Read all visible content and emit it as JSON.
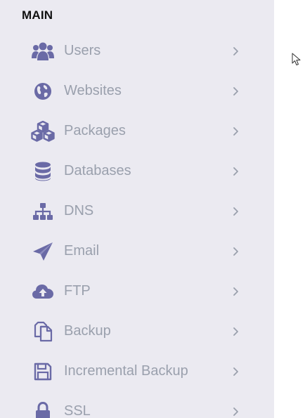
{
  "sidebar": {
    "section_title": "MAIN",
    "items": [
      {
        "label": "Users",
        "icon": "users-icon"
      },
      {
        "label": "Websites",
        "icon": "globe-icon"
      },
      {
        "label": "Packages",
        "icon": "cubes-icon"
      },
      {
        "label": "Databases",
        "icon": "database-icon"
      },
      {
        "label": "DNS",
        "icon": "sitemap-icon"
      },
      {
        "label": "Email",
        "icon": "paper-plane-icon"
      },
      {
        "label": "FTP",
        "icon": "cloud-upload-icon"
      },
      {
        "label": "Backup",
        "icon": "copy-icon"
      },
      {
        "label": "Incremental Backup",
        "icon": "floppy-disk-icon"
      },
      {
        "label": "SSL",
        "icon": "lock-icon"
      }
    ]
  },
  "colors": {
    "sidebar_bg": "#ebeaf1",
    "icon": "#6a6aa6",
    "label": "#9aa0ad",
    "chevron": "#9aa0ad",
    "title": "#111111"
  }
}
